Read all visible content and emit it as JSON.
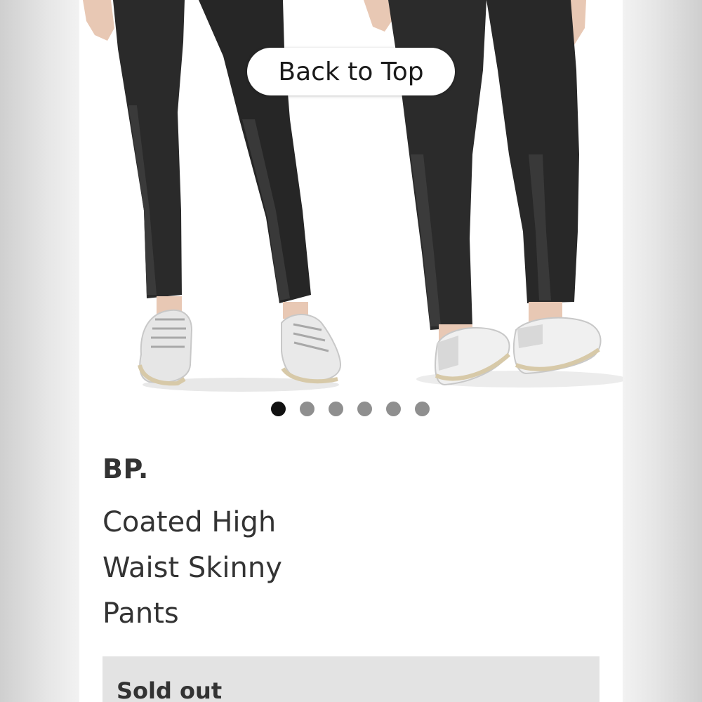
{
  "back_to_top": {
    "label": "Back to Top"
  },
  "gallery": {
    "image_count": 6,
    "active_index": 0,
    "image_subject": "two views of black coated skinny pants worn with white sneakers"
  },
  "product": {
    "brand": "BP.",
    "name": "Coated High Waist Skinny Pants"
  },
  "status": {
    "label": "Sold out"
  },
  "colors": {
    "active_dot": "#111111",
    "inactive_dot": "#8f8f8f",
    "status_bar": "#e3e3e3",
    "text": "#333333"
  }
}
